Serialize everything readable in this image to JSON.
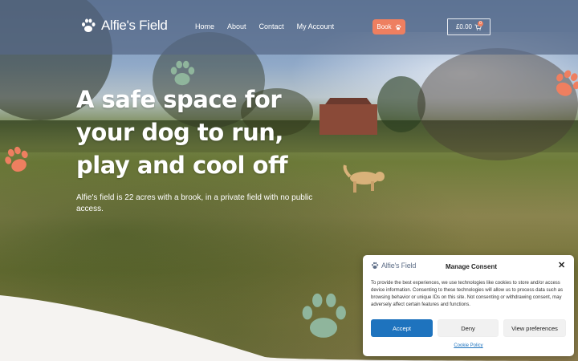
{
  "header": {
    "logo_text": "Alfie's Field",
    "nav": [
      "Home",
      "About",
      "Contact",
      "My Account"
    ],
    "book_label": "Book",
    "cart_total": "£0.00",
    "cart_count": "0"
  },
  "hero": {
    "headline_lines": [
      "A safe space for",
      "your dog to run,",
      "play and cool off"
    ],
    "subtext": "Alfie's field is 22 acres with a brook, in a private field with no public access."
  },
  "consent": {
    "logo_text": "Alfie's Field",
    "title": "Manage Consent",
    "body": "To provide the best experiences, we use technologies like cookies to store and/or access device information. Consenting to these technologies will allow us to process data such as browsing behavior or unique IDs on this site. Not consenting or withdrawing consent, may adversely affect certain features and functions.",
    "accept_label": "Accept",
    "deny_label": "Deny",
    "preferences_label": "View preferences",
    "policy_link": "Cookie Policy"
  },
  "colors": {
    "header_bg": "#56688a",
    "accent_orange": "#ee7f60",
    "paw_green": "#8fb59c",
    "accept_blue": "#1e73be"
  },
  "icons": [
    "paw-icon",
    "cart-icon",
    "close-icon"
  ]
}
